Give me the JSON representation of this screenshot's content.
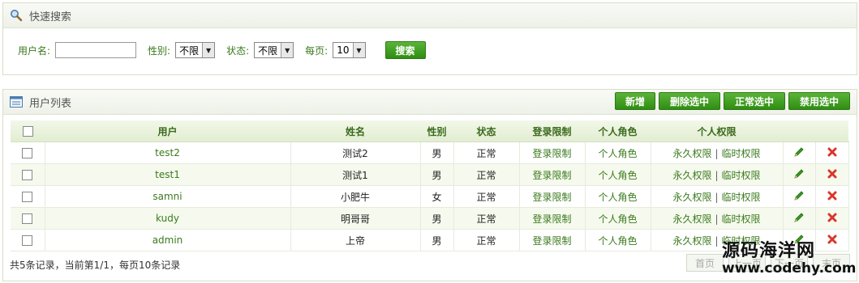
{
  "search": {
    "title": "快速搜索",
    "username_label": "用户名:",
    "username_value": "",
    "gender_label": "性别:",
    "gender_value": "不限",
    "status_label": "状态:",
    "status_value": "不限",
    "pagesize_label": "每页:",
    "pagesize_value": "10",
    "search_button": "搜索"
  },
  "list": {
    "title": "用户列表",
    "buttons": [
      "新增",
      "删除选中",
      "正常选中",
      "禁用选中"
    ],
    "columns": [
      "用户",
      "姓名",
      "性别",
      "状态",
      "登录限制",
      "个人角色",
      "个人权限"
    ],
    "rows": [
      {
        "user": "test2",
        "name": "测试2",
        "gender": "男",
        "status": "正常",
        "login": "登录限制",
        "role": "个人角色",
        "perm1": "永久权限",
        "perm2": "临时权限"
      },
      {
        "user": "test1",
        "name": "测试1",
        "gender": "男",
        "status": "正常",
        "login": "登录限制",
        "role": "个人角色",
        "perm1": "永久权限",
        "perm2": "临时权限"
      },
      {
        "user": "samni",
        "name": "小肥牛",
        "gender": "女",
        "status": "正常",
        "login": "登录限制",
        "role": "个人角色",
        "perm1": "永久权限",
        "perm2": "临时权限"
      },
      {
        "user": "kudy",
        "name": "明哥哥",
        "gender": "男",
        "status": "正常",
        "login": "登录限制",
        "role": "个人角色",
        "perm1": "永久权限",
        "perm2": "临时权限"
      },
      {
        "user": "admin",
        "name": "上帝",
        "gender": "男",
        "status": "正常",
        "login": "登录限制",
        "role": "个人角色",
        "perm1": "永久权限",
        "perm2": "临时权限"
      }
    ],
    "perm_separator": "|",
    "summary": "共5条记录，当前第1/1，每页10条记录",
    "pager": [
      "首页",
      "上一页",
      "下一页",
      "末页"
    ]
  },
  "watermark": {
    "text": "源码海洋网",
    "url": "www.codehy.com"
  },
  "colors": {
    "accent": "#2f8d12",
    "label_green": "#3a7a1c",
    "row_alt": "#f6faee",
    "delete": "#d9362a"
  }
}
